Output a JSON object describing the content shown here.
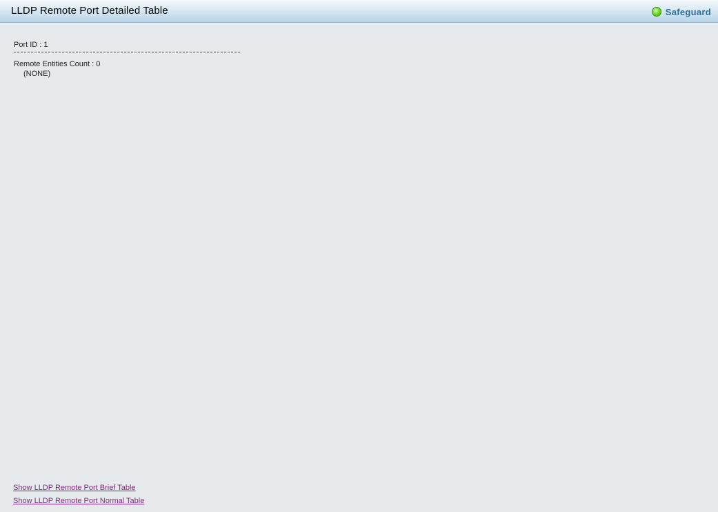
{
  "header": {
    "title": "LLDP Remote Port Detailed Table",
    "safeguard_label": "Safeguard",
    "safeguard_status_color": "#5cc923"
  },
  "details": {
    "port_id_line": "Port ID : 1",
    "remote_entities_line": "Remote Entities Count : 0",
    "none_line": "(NONE)"
  },
  "links": {
    "brief_table": "Show LLDP Remote Port Brief Table",
    "normal_table": "Show LLDP Remote Port Normal Table"
  }
}
